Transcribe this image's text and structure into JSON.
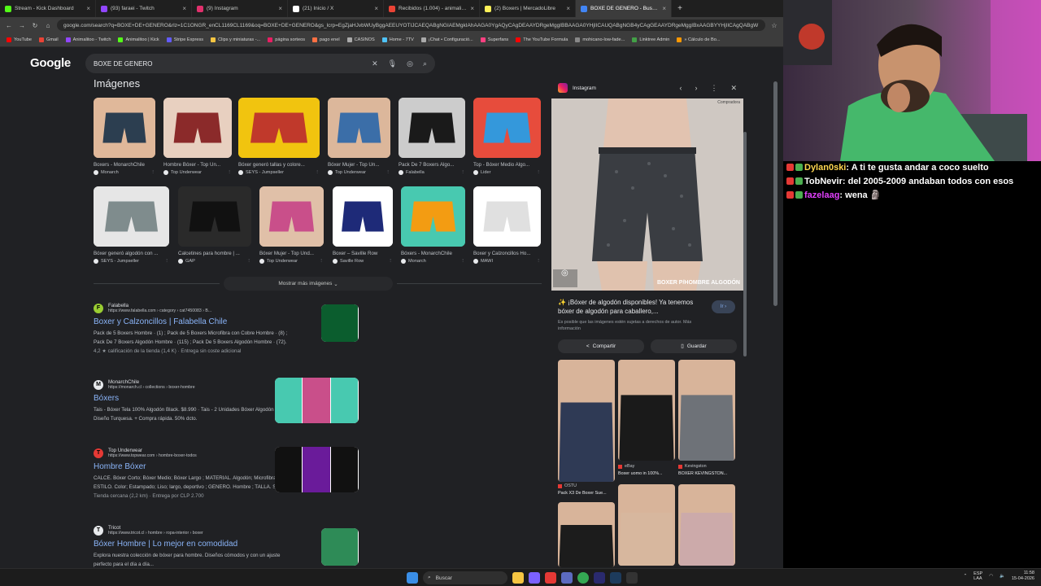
{
  "tabs": [
    {
      "label": "Stream - Kick Dashboard",
      "color": "#53fc18",
      "active": false
    },
    {
      "label": "(93) faraei - Twitch",
      "color": "#9146ff",
      "active": false
    },
    {
      "label": "(9) Instagram",
      "color": "#e1306c",
      "active": false
    },
    {
      "label": "(21) Inicio / X",
      "color": "#ffffff",
      "active": false
    },
    {
      "label": "Recibidos (1.004) - animalito...",
      "color": "#ea4335",
      "active": false
    },
    {
      "label": "(2) Boxers | MercadoLibre",
      "color": "#fff159",
      "active": false
    },
    {
      "label": "BOXE DE GENERO - Buscar con...",
      "color": "#4285f4",
      "active": true
    }
  ],
  "tab_close": "×",
  "new_tab": "+",
  "address": {
    "url": "google.com/search?q=BOXE+DE+GENERO&rlz=1C1ONGR_enCL1169CL1169&oq=BOXE+DE+GENERO&gs_lcrp=EgZjaHJvbWUyBggAEEUYOTIJCAEQABgNGIAEMgkIAhAAGA0YgAQyCAgDEAAYDRgeMggIBBAAGA0YHjIICAUQABgNGB4yCAgGEAAYDRgeMggIBxAAGBYYHjIICAgQABgW"
  },
  "bookmarks": [
    "YouTube",
    "Gmail",
    "Animalitoo - Twitch",
    "Animalitoo | Kick",
    "Stripe Express",
    "Clips y miniaturas -...",
    "página sorteos",
    "pago enel",
    "CASINOS",
    "Home - 7TV",
    "¡Chat • Configuració...",
    "Superfans",
    "The YouTube Formula",
    "mohicano-low-fade...",
    "Linktree Admin",
    "» Cálculo de Bo..."
  ],
  "google": {
    "logo": "Google",
    "query": "BOXE DE GENERO",
    "images_header": "Imágenes",
    "more_button": "Mostrar más imágenes",
    "images": [
      {
        "title": "Boxers - MonarchChile",
        "source": "Monarch"
      },
      {
        "title": "Hombre Bóxer - Top Un...",
        "source": "Top Underwear"
      },
      {
        "title": "Bóxer generó tallas y colore...",
        "source": "SEYS - Jumpseller"
      },
      {
        "title": "Bóxer Mujer - Top Un...",
        "source": "Top Underwear"
      },
      {
        "title": "Pack De 7 Boxers Algo...",
        "source": "Falabella"
      },
      {
        "title": "Top - Bóxer Medio Algo...",
        "source": "Lider"
      },
      {
        "title": "Bóxer generó algodón con ...",
        "source": "SEYS - Jumpseller"
      },
      {
        "title": "Calcetines para hombre | ...",
        "source": "GAP"
      },
      {
        "title": "Bóxer Mujer - Top Und...",
        "source": "Top Underwear"
      },
      {
        "title": "Boxer – Saville Row",
        "source": "Saville Row"
      },
      {
        "title": "Bóxers - MonarchChile",
        "source": "Monarch"
      },
      {
        "title": "Boxer y Calzoncillos Ho...",
        "source": "MAWI"
      }
    ],
    "results": [
      {
        "name": "Falabella",
        "url": "https://www.falabella.com › category › cat7450083 › B...",
        "title": "Boxer y Calzoncillos | Falabella Chile",
        "snippet": "Pack de 5 Boxers Hombre · (1) ; Pack de 5 Boxers Microfibra con Cobre Hombre · (8) ; Pack De 7 Boxers Algodón Hombre · (115) ; Pack De 5 Boxers Algodón Hombre · (72).",
        "meta": "4,2 ★ calificación de la tienda (1,4 K) · Entrega sin coste adicional"
      },
      {
        "name": "MonarchChile",
        "url": "https://monarch.cl › collections › boxer-hombre",
        "title": "Bóxers",
        "snippet": "Tais - Bóxer Tela 100% Algodón Black. $8.990 · Tais - 2 Unidades Bóxer Algodón Spandex Diseño Turquesa. + Compra rápida. 50% dcto.",
        "meta": ""
      },
      {
        "name": "Top Underwear",
        "url": "https://www.topwear.com › hombre-boxer-todos",
        "title": "Hombre Bóxer",
        "snippet": "CALCE. Bóxer Corto; Bóxer Medio; Bóxer Largo ; MATERIAL. Algodón; Microfibra; Cobre ; ESTILO. Color; Estampado; Liso; largo, deportivo ; GENERO. Hombre ; TALLA. S",
        "meta": "Tienda cercana (2,2 km) · Entrega por CLP 2.700"
      },
      {
        "name": "Tricot",
        "url": "https://www.tricot.cl › hombre › ropa-interior › boxer",
        "title": "Bóxer Hombre | Lo mejor en comodidad",
        "snippet": "Explora nuestra colección de bóxer para hombre. Diseños cómodos y con un ajuste perfecto para el día a día...",
        "meta": ""
      }
    ]
  },
  "panel": {
    "source": "Instagram",
    "watermark": "Compradora",
    "overlay_text": "BOXER P/HOMBRE ALGODÓN",
    "caption": "✨ ¡Bóxer de algodón disponibles! Ya tenemos bóxer de algodón para caballero,...",
    "visit": "Ir",
    "note": "Es posible que las imágenes estén sujetas a derechos de autor. Más información",
    "share": "Compartir",
    "save": "Guardar",
    "related": [
      {
        "source": "OSTU",
        "title": "Pack X3 De Boxer Sue..."
      },
      {
        "source": "eBay",
        "title": "Boxer uomo in 100%..."
      },
      {
        "source": "Kevingston",
        "title": "BOXER KEVINGSTON..."
      }
    ]
  },
  "chat": [
    {
      "user": "Dylan0ski",
      "color": "#ffd54f",
      "text": "A ti te gusta andar a coco suelto"
    },
    {
      "user": "TobNevir",
      "color": "#ffffff",
      "text": "del 2005-2009 andaban todos con esos"
    },
    {
      "user": "fazelaag",
      "color": "#e040fb",
      "text": "wena 🗿"
    }
  ],
  "taskbar": {
    "search": "Buscar",
    "lang": "ESP\nLAA",
    "time": "11:58",
    "date": "15-04-2026"
  }
}
